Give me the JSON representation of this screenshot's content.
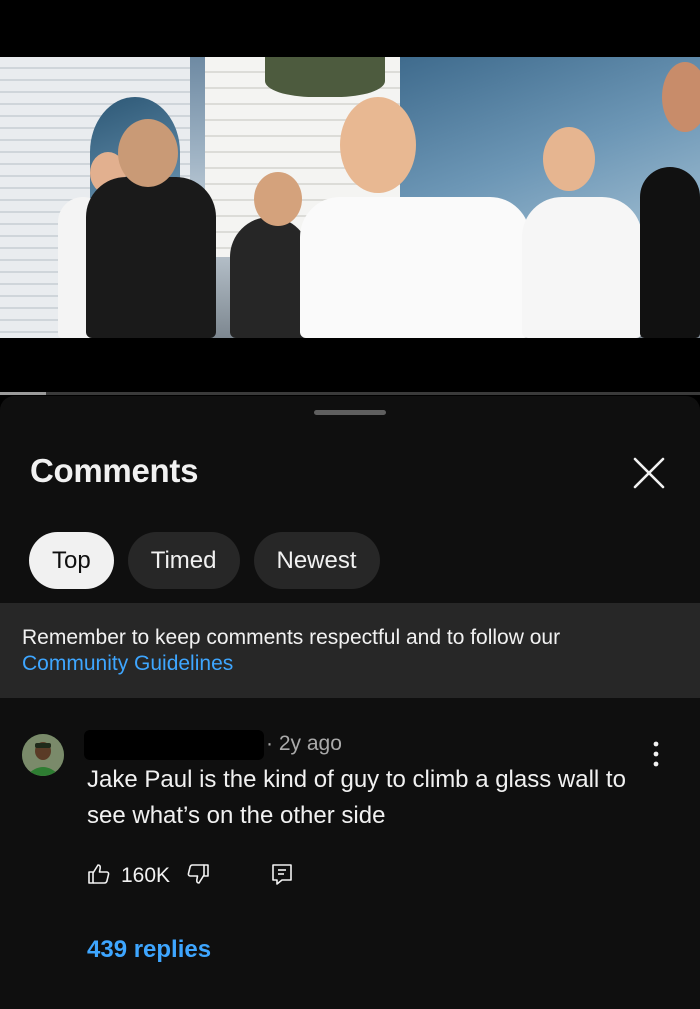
{
  "video": {
    "progress_fraction": 0.065
  },
  "sheet": {
    "title": "Comments",
    "close_icon": "close-icon",
    "chips": [
      {
        "label": "Top",
        "active": true
      },
      {
        "label": "Timed",
        "active": false
      },
      {
        "label": "Newest",
        "active": false
      }
    ],
    "notice": {
      "text": "Remember to keep comments respectful and to follow our",
      "link": "Community Guidelines"
    }
  },
  "comment": {
    "age": "· 2y ago",
    "text": "Jake Paul is the kind of guy to climb a glass wall to see what’s on the other side",
    "likes": "160K",
    "replies": "439 replies"
  },
  "colors": {
    "background": "#0f0f0f",
    "chip_active": "#f1f1f1",
    "chip": "#272727",
    "link": "#3ea6ff",
    "secondary_text": "#aaaaaa"
  }
}
